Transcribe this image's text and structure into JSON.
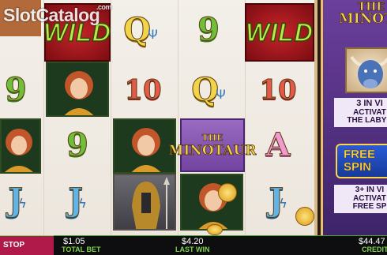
{
  "watermark": {
    "text": "SlotCatalog",
    "suffix": ".com"
  },
  "reels": {
    "row1": [
      {
        "type": "wild",
        "label": "WILD"
      },
      {
        "type": "letter",
        "label": "Q"
      },
      {
        "type": "number",
        "label": "9"
      },
      {
        "type": "wild",
        "label": "WILD"
      }
    ],
    "row2": [
      {
        "type": "number",
        "label": "9"
      },
      {
        "type": "number",
        "label": "10"
      },
      {
        "type": "letter",
        "label": "Q"
      },
      {
        "type": "number",
        "label": "10"
      }
    ],
    "row3": [
      {
        "type": "number",
        "label": "9"
      },
      {
        "type": "logo",
        "label_top": "THE",
        "label_bottom": "MINOTAUR"
      },
      {
        "type": "letter",
        "label": "A"
      }
    ],
    "row4": [
      {
        "type": "letter",
        "label": "J"
      },
      {
        "type": "letter",
        "label": "J"
      },
      {
        "type": "letter",
        "label": "J"
      }
    ]
  },
  "side_panel": {
    "title_top": "THE",
    "title_bottom": "MINOTA",
    "info1": [
      "3 IN VI",
      "ACTIVAT",
      "THE LABYR"
    ],
    "badge": [
      "FREE",
      "SPIN"
    ],
    "info2": [
      "3+ IN VI",
      "ACTIVAT",
      "FREE SP"
    ]
  },
  "bottom_bar": {
    "stop_label": "STOP",
    "total_bet_value": "$1.05",
    "total_bet_label": "TOTAL BET",
    "last_win_value": "$4.20",
    "last_win_label": "LAST WIN",
    "credit_value": "$44.47",
    "credit_label": "CREDIT"
  },
  "colors": {
    "accent": "#7fd34a",
    "stop": "#b01a4a",
    "wild": "#c8242a",
    "panel": "#6b3f9c"
  },
  "icons": [
    "trident-icon",
    "lightning-icon",
    "coin-icon",
    "bull-icon",
    "sword-icon"
  ]
}
